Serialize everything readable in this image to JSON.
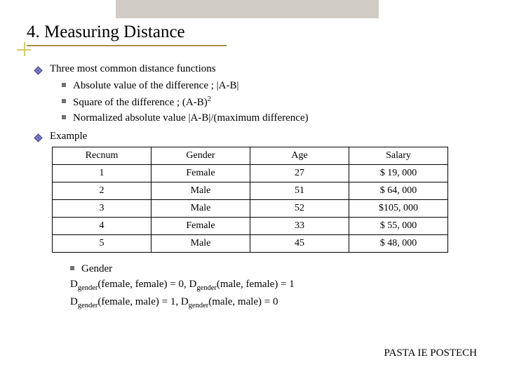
{
  "title": "4. Measuring Distance",
  "b1": "Three most common distance functions",
  "s1a": "Absolute value of the difference ; |A-B|",
  "s1b_pre": "Square of the difference ; (A-B)",
  "s1b_sup": "2",
  "s1c": "Normalized absolute value |A-B|/(maximum difference)",
  "b2": "Example",
  "h1": "Recnum",
  "h2": "Gender",
  "h3": "Age",
  "h4": "Salary",
  "r": [
    [
      "1",
      "Female",
      "27",
      "$ 19, 000"
    ],
    [
      "2",
      "Male",
      "51",
      "$ 64, 000"
    ],
    [
      "3",
      "Male",
      "52",
      "$105, 000"
    ],
    [
      "4",
      "Female",
      "33",
      "$ 55, 000"
    ],
    [
      "5",
      "Male",
      "45",
      "$ 48, 000"
    ]
  ],
  "g_label": "Gender",
  "g_sub": "gender",
  "g1": "(female, female) =  0, D",
  "g2": "(male, female) = 1",
  "g3": "(female, male) = 1,    D",
  "g4": "(male, male) = 0",
  "footer": "PASTA IE POSTECH",
  "chart_data": {
    "type": "table",
    "headers": [
      "Recnum",
      "Gender",
      "Age",
      "Salary"
    ],
    "rows": [
      [
        "1",
        "Female",
        "27",
        "$ 19, 000"
      ],
      [
        "2",
        "Male",
        "51",
        "$ 64, 000"
      ],
      [
        "3",
        "Male",
        "52",
        "$105, 000"
      ],
      [
        "4",
        "Female",
        "33",
        "$ 55, 000"
      ],
      [
        "5",
        "Male",
        "45",
        "$ 48, 000"
      ]
    ]
  }
}
